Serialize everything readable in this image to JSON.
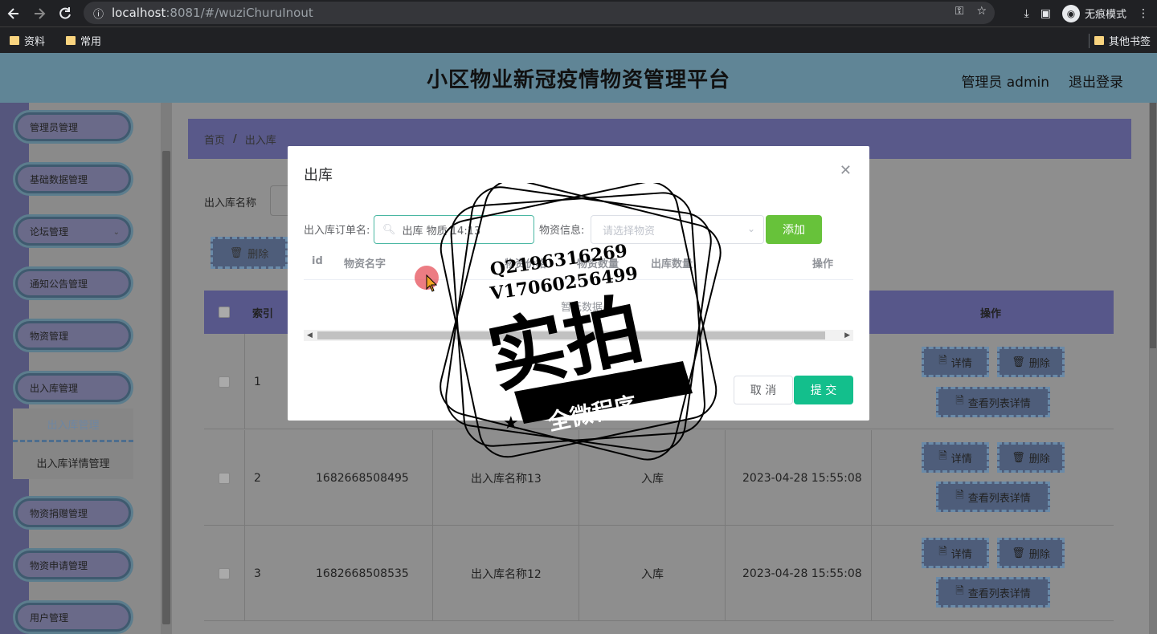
{
  "browser": {
    "url_host": "localhost",
    "url_rest": ":8081/#/wuziChuruInout",
    "incognito_label": "无痕模式",
    "bookmarks": [
      "资料",
      "常用"
    ],
    "other_bookmarks": "其他书签"
  },
  "header": {
    "title": "小区物业新冠疫情物资管理平台",
    "user": "管理员 admin",
    "logout": "退出登录"
  },
  "sidebar": {
    "items": [
      "管理员管理",
      "基础数据管理",
      "论坛管理",
      "通知公告管理",
      "物资管理",
      "出入库管理",
      "物资捐赠管理",
      "物资申请管理",
      "用户管理"
    ],
    "sub_items": [
      "出入库管理",
      "出入库详情管理"
    ]
  },
  "main": {
    "breadcrumb": [
      "首页",
      "出入库"
    ],
    "breadcrumb_sep": "/",
    "search_label": "出入库名称",
    "delete_label": "删除",
    "columns": [
      "索引",
      "操作"
    ],
    "rows": [
      {
        "index": "1",
        "code": "",
        "name": "",
        "type": "",
        "time": ""
      },
      {
        "index": "2",
        "code": "1682668508495",
        "name": "出入库名称13",
        "type": "入库",
        "time": "2023-04-28 15:55:08"
      },
      {
        "index": "3",
        "code": "1682668508535",
        "name": "出入库名称12",
        "type": "入库",
        "time": "2023-04-28 15:55:08"
      }
    ],
    "actions": {
      "detail": "详情",
      "delete": "删除",
      "list_detail": "查看列表详情"
    }
  },
  "dialog": {
    "title": "出库",
    "order_label": "出入库订单名:",
    "order_value": "出库 物质 14:13",
    "goods_label": "物资信息:",
    "goods_placeholder": "请选择物资",
    "add_label": "添加",
    "inner_columns": [
      "id",
      "物资名字",
      "物资价格",
      "物资数量",
      "出库数量",
      "操作"
    ],
    "empty_text": "暂无数据",
    "cancel_label": "取 消",
    "submit_label": "提 交"
  },
  "watermark": {
    "line1": "Q2196316269",
    "line2": "V17060256499",
    "big": "实拍",
    "banner": "全微程序"
  },
  "colors": {
    "header_bg": "#608596",
    "add_green": "#67c23a",
    "submit_teal": "#13bf8c"
  }
}
